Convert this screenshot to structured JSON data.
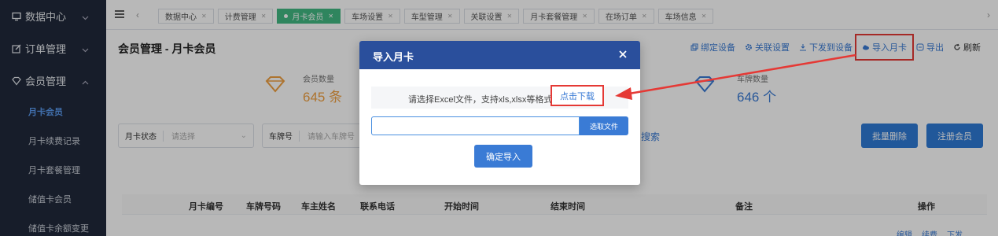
{
  "sidebar": {
    "groups": [
      {
        "label": "数据中心",
        "icon": "monitor-icon"
      },
      {
        "label": "订单管理",
        "icon": "edit-icon"
      },
      {
        "label": "会员管理",
        "icon": "diamond-icon"
      }
    ],
    "items": [
      "月卡会员",
      "月卡续费记录",
      "月卡套餐管理",
      "储值卡会员",
      "储值卡余额变更"
    ]
  },
  "tabs": [
    "数据中心",
    "计费管理",
    "月卡会员",
    "车场设置",
    "车型管理",
    "关联设置",
    "月卡套餐管理",
    "在场订单",
    "车场信息"
  ],
  "page": {
    "title": "会员管理 - 月卡会员",
    "toolbar": {
      "bind_device": "绑定设备",
      "relation_settings": "关联设置",
      "push_to_device": "下发到设备",
      "import_card": "导入月卡",
      "export": "导出",
      "refresh": "刷新"
    },
    "stats": {
      "member_count_label": "会员数量",
      "member_count_value": "645 条",
      "plate_count_label": "车牌数量",
      "plate_count_value": "646 个"
    },
    "filters": {
      "card_status_label": "月卡状态",
      "card_status_placeholder": "请选择",
      "plate_label": "车牌号",
      "plate_placeholder": "请输入车牌号",
      "search": "搜索"
    },
    "buttons": {
      "batch_delete": "批量删除",
      "register_member": "注册会员"
    },
    "table": {
      "columns": [
        "月卡编号",
        "车牌号码",
        "车主姓名",
        "联系电话",
        "开始时间",
        "结束时间",
        "备注",
        "操作"
      ],
      "row_actions": [
        "编辑",
        "续费",
        "下发"
      ]
    }
  },
  "modal": {
    "title": "导入月卡",
    "hint": "请选择Excel文件，支持xls,xlsx等格式。",
    "download": "点击下载",
    "choose_file": "选取文件",
    "confirm": "确定导入"
  },
  "colors": {
    "sidebar_bg": "#20293b",
    "accent_blue": "#3a7bd5",
    "modal_header": "#2a4f9c",
    "active_tab": "#42b983",
    "annotation_red": "#e53935"
  }
}
